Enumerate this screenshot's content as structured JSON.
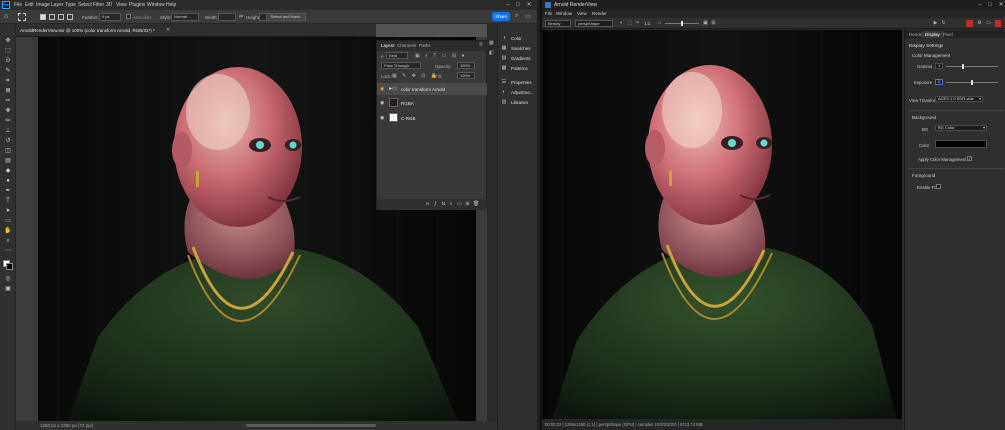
{
  "photoshop": {
    "menu": [
      "File",
      "Edit",
      "Image",
      "Layer",
      "Type",
      "Select",
      "Filter",
      "3D",
      "View",
      "Plugins",
      "Window",
      "Help"
    ],
    "options": {
      "feather_label": "Feather:",
      "feather_value": "0 px",
      "antialias_label": "Anti-alias",
      "style_label": "Style:",
      "style_value": "Normal",
      "width_label": "Width:",
      "height_label": "Height:",
      "select_mask": "Select and Mask...",
      "share": "Share"
    },
    "document_tab": "ArnoldRenderView.exr @ 100% (color transform Arnold, RGB/32*) *",
    "status": "1250 px x 1250 px (72 ppi)",
    "layers_panel": {
      "tabs": [
        "Layers",
        "Channels",
        "Paths"
      ],
      "kind": "Kind",
      "blend": "Pass Through",
      "opacity_label": "Opacity:",
      "opacity_value": "100%",
      "lock_label": "Lock:",
      "fill_label": "Fill:",
      "fill_value": "100%",
      "layers": [
        {
          "name": "color transform Arnold"
        },
        {
          "name": "RGBA"
        },
        {
          "name": "C-RGB"
        }
      ]
    },
    "side_panels": [
      "Color",
      "Swatches",
      "Gradients",
      "Patterns",
      "Properties",
      "Adjustme...",
      "Libraries"
    ]
  },
  "arnold": {
    "title": "Arnold RenderView",
    "menu": [
      "File",
      "Window",
      "View",
      "Render"
    ],
    "toolbar": {
      "aov": "Beauty",
      "camera": "perspShape",
      "ratio": "1:1"
    },
    "status": "00:00:32 | 1250x1250 (1:1) | perspShape (GPU) | samples 10/2/2/2/2/0 | 5713.74 MB",
    "panel": {
      "tabs": [
        "Render",
        "Display",
        "Pixel"
      ],
      "active_tab": "Display",
      "section_title": "Display Settings",
      "color_management": "Color Management",
      "gamma_label": "Gamma",
      "gamma_value": "1",
      "exposure_label": "Exposure",
      "exposure_value": "0",
      "view_transform_label": "View Transform",
      "view_transform_value": "ACES 1.0 SDR-vide",
      "background": "Background",
      "bg_label": "BG",
      "bg_value": "BG Color",
      "color_label": "Color",
      "apply_cm": "Apply Color Management",
      "foreground": "Foreground",
      "enable_fg": "Enable FG"
    }
  },
  "colors": {
    "ps_accent": "#31a8ff",
    "share_blue": "#1473e6",
    "render_red": "#c62828"
  }
}
